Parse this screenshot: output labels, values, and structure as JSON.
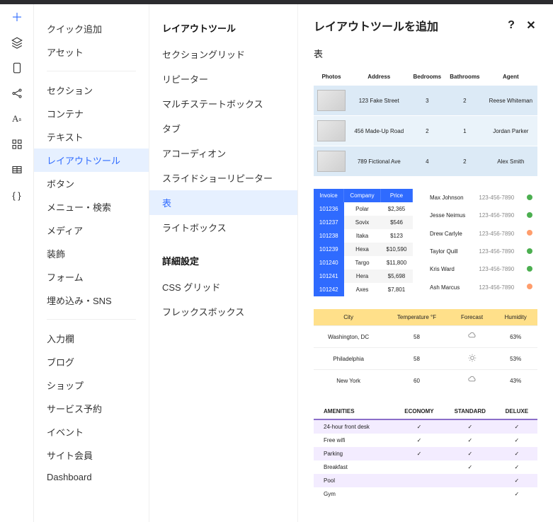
{
  "iconbar": [
    "plus",
    "layers",
    "page",
    "share-nodes",
    "text-a",
    "apps-grid",
    "table",
    "braces"
  ],
  "categories": {
    "group1": [
      "クイック追加",
      "アセット"
    ],
    "group2": [
      "セクション",
      "コンテナ",
      "テキスト",
      "レイアウトツール",
      "ボタン",
      "メニュー・検索",
      "メディア",
      "装飾",
      "フォーム",
      "埋め込み・SNS"
    ],
    "group3": [
      "入力欄",
      "ブログ",
      "ショップ",
      "サービス予約",
      "イベント",
      "サイト会員",
      "Dashboard"
    ],
    "active": "レイアウトツール"
  },
  "subpanel": {
    "heading1": "レイアウトツール",
    "items1": [
      "セクショングリッド",
      "リピーター",
      "マルチステートボックス",
      "タブ",
      "アコーディオン",
      "スライドショーリピーター",
      "表",
      "ライトボックス"
    ],
    "heading2": "詳細設定",
    "items2": [
      "CSS グリッド",
      "フレックスボックス"
    ],
    "active": "表"
  },
  "main": {
    "title": "レイアウトツールを追加",
    "section_label": "表",
    "table1": {
      "headers": [
        "Photos",
        "Address",
        "Bedrooms",
        "Bathrooms",
        "Agent"
      ],
      "rows": [
        {
          "address": "123 Fake Street",
          "bedrooms": "3",
          "bathrooms": "2",
          "agent": "Reese Whiteman"
        },
        {
          "address": "456 Made-Up Road",
          "bedrooms": "2",
          "bathrooms": "1",
          "agent": "Jordan Parker"
        },
        {
          "address": "789 Fictional Ave",
          "bedrooms": "4",
          "bathrooms": "2",
          "agent": "Alex Smith"
        }
      ]
    },
    "table2": {
      "headers": [
        "Invoice",
        "Company",
        "Price"
      ],
      "rows": [
        [
          "101236",
          "Polar",
          "$2,365"
        ],
        [
          "101237",
          "Sovix",
          "$546"
        ],
        [
          "101238",
          "Itaka",
          "$123"
        ],
        [
          "101239",
          "Hexa",
          "$10,590"
        ],
        [
          "101240",
          "Targo",
          "$11,800"
        ],
        [
          "101241",
          "Hera",
          "$5,698"
        ],
        [
          "101242",
          "Axes",
          "$7,801"
        ]
      ]
    },
    "table3": {
      "rows": [
        {
          "name": "Max Johnson",
          "phone": "123-456-7890",
          "dot": "g"
        },
        {
          "name": "Jesse Neimus",
          "phone": "123-456-7890",
          "dot": "g"
        },
        {
          "name": "Drew Carlyle",
          "phone": "123-456-7890",
          "dot": "o"
        },
        {
          "name": "Taylor Quill",
          "phone": "123-456-7890",
          "dot": "g"
        },
        {
          "name": "Kris Ward",
          "phone": "123-456-7890",
          "dot": "g"
        },
        {
          "name": "Ash Marcus",
          "phone": "123-456-7890",
          "dot": "o"
        }
      ]
    },
    "table4": {
      "headers": [
        "City",
        "Temperature °F",
        "Forecast",
        "Humidity"
      ],
      "rows": [
        {
          "city": "Washington, DC",
          "temp": "58",
          "icon": "cloud",
          "humidity": "63%"
        },
        {
          "city": "Philadelphia",
          "temp": "58",
          "icon": "sun",
          "humidity": "53%"
        },
        {
          "city": "New York",
          "temp": "60",
          "icon": "cloud",
          "humidity": "43%"
        }
      ]
    },
    "table5": {
      "headers": [
        "AMENITIES",
        "ECONOMY",
        "STANDARD",
        "DELUXE"
      ],
      "rows": [
        {
          "label": "24-hour front desk",
          "cols": [
            true,
            true,
            true
          ]
        },
        {
          "label": "Free wifi",
          "cols": [
            true,
            true,
            true
          ]
        },
        {
          "label": "Parking",
          "cols": [
            true,
            true,
            true
          ]
        },
        {
          "label": "Breakfast",
          "cols": [
            false,
            true,
            true
          ]
        },
        {
          "label": "Pool",
          "cols": [
            false,
            false,
            true
          ]
        },
        {
          "label": "Gym",
          "cols": [
            false,
            false,
            true
          ]
        }
      ]
    }
  }
}
